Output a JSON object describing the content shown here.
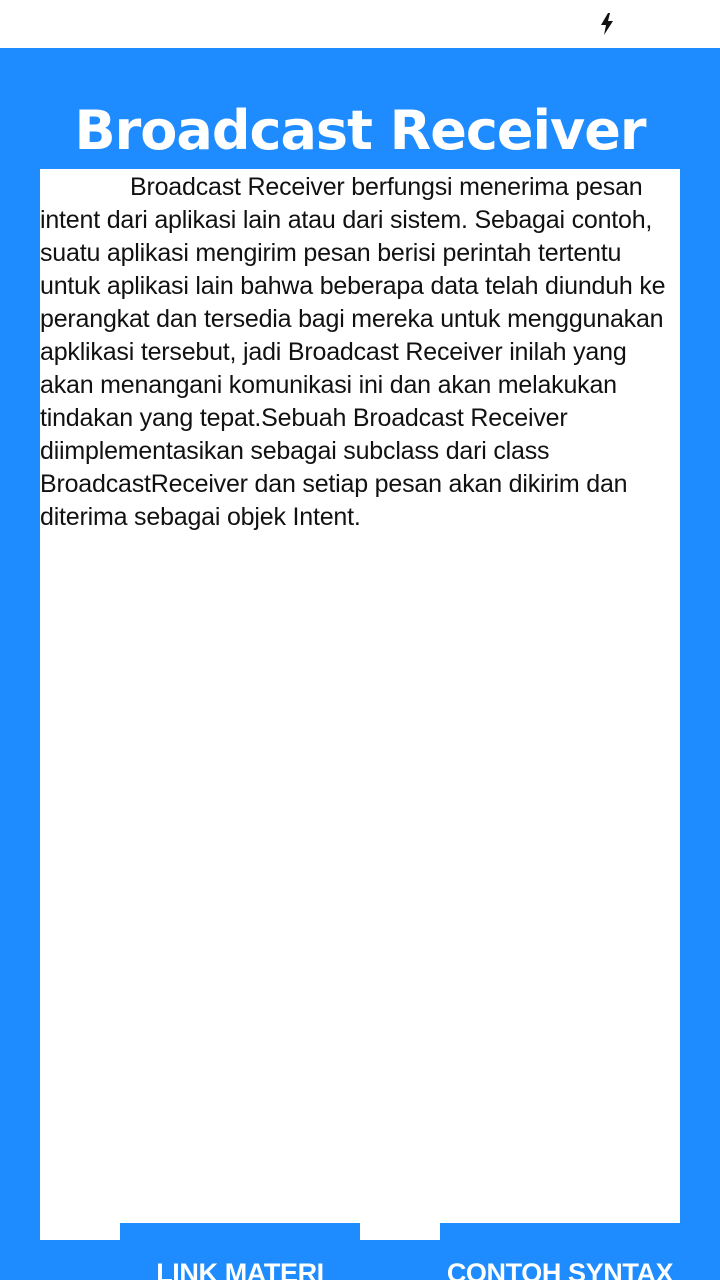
{
  "status_bar": {
    "icons": [
      "flash-icon"
    ]
  },
  "header": {
    "title": "Broadcast Receiver"
  },
  "content": {
    "paragraph": "Broadcast Receiver berfungsi menerima pesan intent dari aplikasi lain atau dari sistem. Sebagai contoh, suatu aplikasi mengirim pesan berisi perintah tertentu untuk aplikasi lain bahwa beberapa data telah diunduh ke perangkat dan tersedia bagi mereka untuk menggunakan apklikasi tersebut, jadi Broadcast Receiver inilah yang akan menangani komunikasi ini dan akan melakukan tindakan yang tepat.Sebuah Broadcast Receiver diimplementasikan sebagai subclass dari class BroadcastReceiver dan setiap pesan akan dikirim dan diterima sebagai objek Intent."
  },
  "buttons": {
    "link_materi": "LINK MATERI",
    "contoh_syntax": "CONTOH SYNTAX"
  },
  "colors": {
    "primary": "#1e8cff",
    "surface": "#ffffff",
    "text": "#111111"
  }
}
